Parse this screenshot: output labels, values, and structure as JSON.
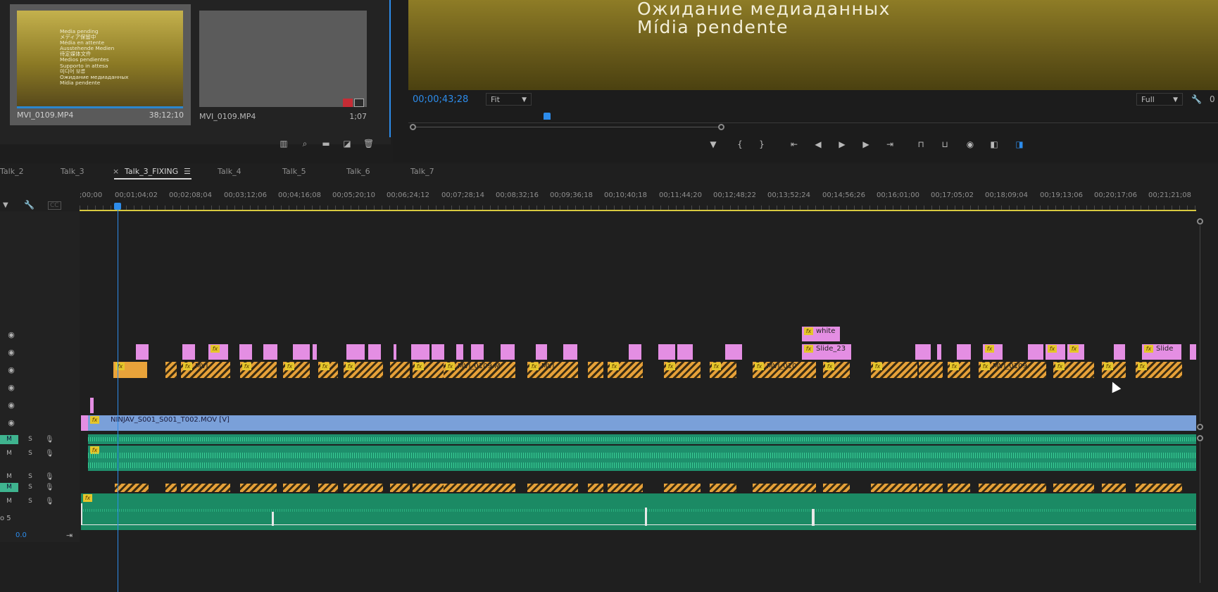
{
  "project_panel": {
    "thumbnails": [
      {
        "name": "MVI_0109.MP4",
        "duration": "38;12;10",
        "overlay_lines": [
          "Media pending",
          "メディア保留中",
          "Média en attente",
          "Ausstehende Medien",
          "待定媒体文件",
          "Medios pendientes",
          "Supporto in attesa",
          "미디어 보류",
          "Ожидание медиаданных",
          "Mídia pendente"
        ]
      },
      {
        "name": "MVI_0109.MP4",
        "duration": "1;07"
      }
    ],
    "tools": {
      "list_view_icon": "list-view-icon",
      "find_icon": "find-icon",
      "new_bin_icon": "folder-icon",
      "new_item_icon": "new-item-icon",
      "clear_icon": "trash-icon"
    }
  },
  "program_monitor": {
    "overlay_lines": [
      "Ожидание медиаданных",
      "Mídia pendente"
    ],
    "timecode": "00;00;43;28",
    "zoom": "Fit",
    "resolution": "Full",
    "right_value": "0"
  },
  "timeline": {
    "tabs": [
      "Talk_2",
      "Talk_3",
      "Talk_3_FIXING",
      "Talk_4",
      "Talk_5",
      "Talk_6",
      "Talk_7"
    ],
    "active_tab": "Talk_3_FIXING",
    "close_glyph": "×",
    "menu_glyph": "☰",
    "ruler_labels": [
      ";00;00",
      "00;01;04;02",
      "00;02;08;04",
      "00;03;12;06",
      "00;04;16;08",
      "00;05;20;10",
      "00;06;24;12",
      "00;07;28;14",
      "00;08;32;16",
      "00;09;36;18",
      "00;10;40;18",
      "00;11;44;20",
      "00;12;48;22",
      "00;13;52;24",
      "00;14;56;26",
      "00;16;01;00",
      "00;17;05;02",
      "00;18;09;04",
      "00;19;13;06",
      "00;20;17;06",
      "00;21;21;08"
    ],
    "clips": {
      "white": "white",
      "slide_23": "Slide_23",
      "slide": "Slide",
      "mvi_1": "MVI",
      "mvi_2": "MVI_0109.M",
      "mvi_3": "MVI",
      "mvi_4": "MVI_010",
      "mvi_5": "MVI_0109.",
      "ninjav": "NINJAV_S001_S001_T002.MOV [V]"
    },
    "audio_labels": {
      "m": "M",
      "s": "S",
      "track_label": "o 5",
      "volume": "0.0"
    },
    "fx_badge": "fx",
    "colors": {
      "playhead": "#2d8ceb",
      "pink_clip": "#e48ee3",
      "orange_clip": "#e9a33a",
      "video_clip": "#7aa0d9",
      "audio": "#1e8f6c"
    }
  }
}
